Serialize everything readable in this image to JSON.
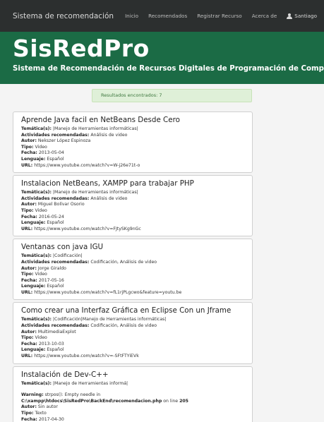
{
  "navbar": {
    "brand": "Sistema de recomendación",
    "items": [
      "Inicio",
      "Recomendados",
      "Registrar Recurso",
      "Acerca de"
    ],
    "user": "Santiago"
  },
  "header": {
    "title": "SisRedPro",
    "subtitle": "Sistema de Recomendación de Recursos Digitales de Programación de Computadoras"
  },
  "alert": "Resultados encontrados: 7",
  "labels": {
    "tematica": "Temática(s):",
    "actividades": "Actividades recomendadas:",
    "autor": "Autor:",
    "tipo": "Tipo:",
    "fecha": "Fecha:",
    "lenguaje": "Lenguaje:",
    "url": "URL:",
    "warning": "Warning:"
  },
  "results": [
    {
      "title": "Aprende Java facil en NetBeans Desde Cero",
      "tematica": "|Manejo de Herramientas informáticas|",
      "actividades": "Análisis de video",
      "autor": "Nekszer López Espinoza",
      "tipo": "Video",
      "fecha": "2013-05-04",
      "lenguaje": "Español",
      "url": "https://www.youtube.com/watch?v=W-j26e71t-o"
    },
    {
      "title": "Instalacion NetBeans, XAMPP para trabajar PHP",
      "tematica": "|Manejo de Herramientas informáticas|",
      "actividades": "Análisis de video",
      "autor": "Miguel Bolívar Osorio",
      "tipo": "Video",
      "fecha": "2016-05-24",
      "lenguaje": "Español",
      "url": "https://www.youtube.com/watch?v=FJtySKg9nGc"
    },
    {
      "title": "Ventanas con java IGU",
      "tematica": "|Codificación|",
      "actividades": "Codificación, Análisis de video",
      "autor": "Jorge Giraldo",
      "tipo": "Video",
      "fecha": "2017-05-16",
      "lenguaje": "Español",
      "url": "https://www.youtube.com/watch?v=fL1rjPLgcwo&feature=youtu.be"
    },
    {
      "title": "Como crear una Interfaz Gráfica en Eclipse Con un Jframe",
      "tematica": "|Codificación|Manejo de Herramientas informáticas|",
      "actividades": "Codificación, Análisis de video",
      "autor": "MultimediaExplot",
      "tipo": "Video",
      "fecha": "2013-10-03",
      "lenguaje": "Español",
      "url": "https://www.youtube.com/watch?v=-SFtFTYiEVk"
    },
    {
      "title": "Instalación de Dev-C++",
      "tematica": "|Manejo de Herramientas informá|",
      "warning_text": "strpos(): Empty needle in",
      "warning_path": "C:\\xampp\\htdocs\\SisRedPro\\BackEnd\\recomendacion.php",
      "warning_online": "on line",
      "warning_line": "205",
      "autor": "Sin autor",
      "tipo": "Texto",
      "fecha": "2017-04-30"
    }
  ]
}
